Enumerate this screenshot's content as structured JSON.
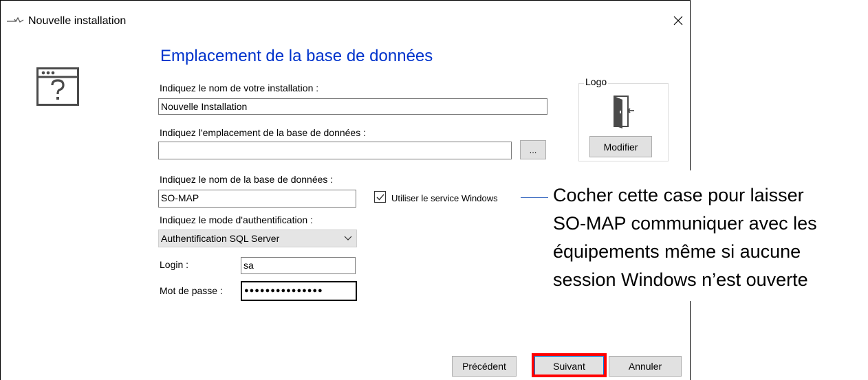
{
  "window": {
    "title": "Nouvelle installation"
  },
  "page": {
    "heading": "Emplacement de la base de données"
  },
  "installation_name": {
    "label": "Indiquez le nom de votre installation :",
    "value": "Nouvelle Installation"
  },
  "db_location": {
    "label": "Indiquez l'emplacement de la base de données :",
    "value": "",
    "browse_label": "..."
  },
  "db_name": {
    "label": "Indiquez le nom de la base de données :",
    "value": "SO-MAP"
  },
  "windows_service": {
    "label": "Utiliser le service Windows",
    "checked": true
  },
  "auth_mode": {
    "label": "Indiquez le mode d'authentification :",
    "selected": "Authentification SQL Server"
  },
  "login": {
    "label": "Login :",
    "value": "sa"
  },
  "password": {
    "label": "Mot de passe :",
    "value": "●●●●●●●●●●●●●●●"
  },
  "logo": {
    "group_label": "Logo",
    "modify_label": "Modifier"
  },
  "buttons": {
    "previous": "Précédent",
    "next": "Suivant",
    "cancel": "Annuler"
  },
  "callout": {
    "lines": [
      "Cocher cette case pour laisser",
      "SO-MAP communiquer avec les",
      "équipements même si aucune",
      "session Windows n’est ouverte"
    ]
  },
  "colors": {
    "heading": "#0033cc",
    "highlight": "#ff0000",
    "callout_line": "#4472c4"
  }
}
